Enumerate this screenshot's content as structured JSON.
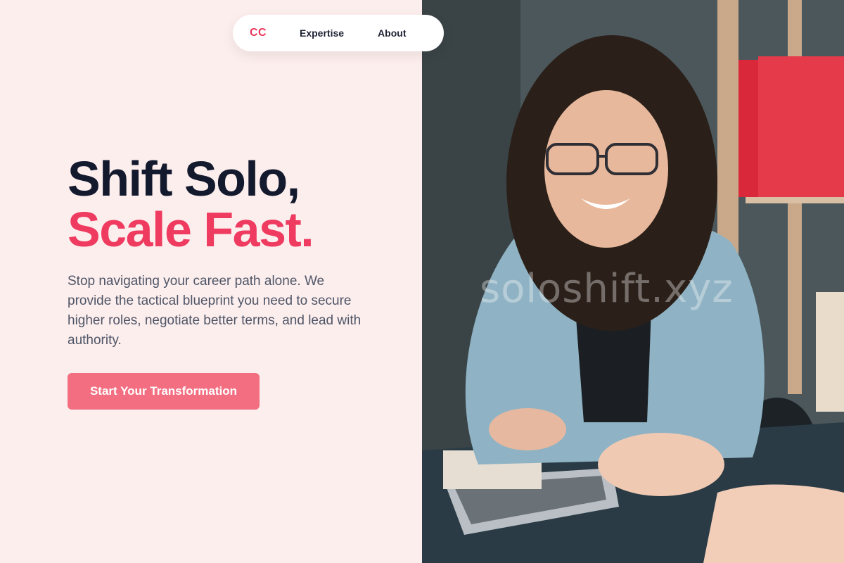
{
  "nav": {
    "logo": "CC",
    "links": [
      "Expertise",
      "About"
    ]
  },
  "hero": {
    "headline_line1": "Shift Solo,",
    "headline_line2": "Scale Fast.",
    "description": "Stop navigating your career path alone. We provide the tactical blueprint you need to secure higher roles, negotiate better terms, and lead with authority.",
    "cta_label": "Start Your Transformation"
  },
  "photo": {
    "watermark": "soloshift.xyz"
  },
  "colors": {
    "accent": "#ee3b5f",
    "cta": "#f26e80",
    "background": "#fdeeee",
    "heading": "#141a2e"
  }
}
